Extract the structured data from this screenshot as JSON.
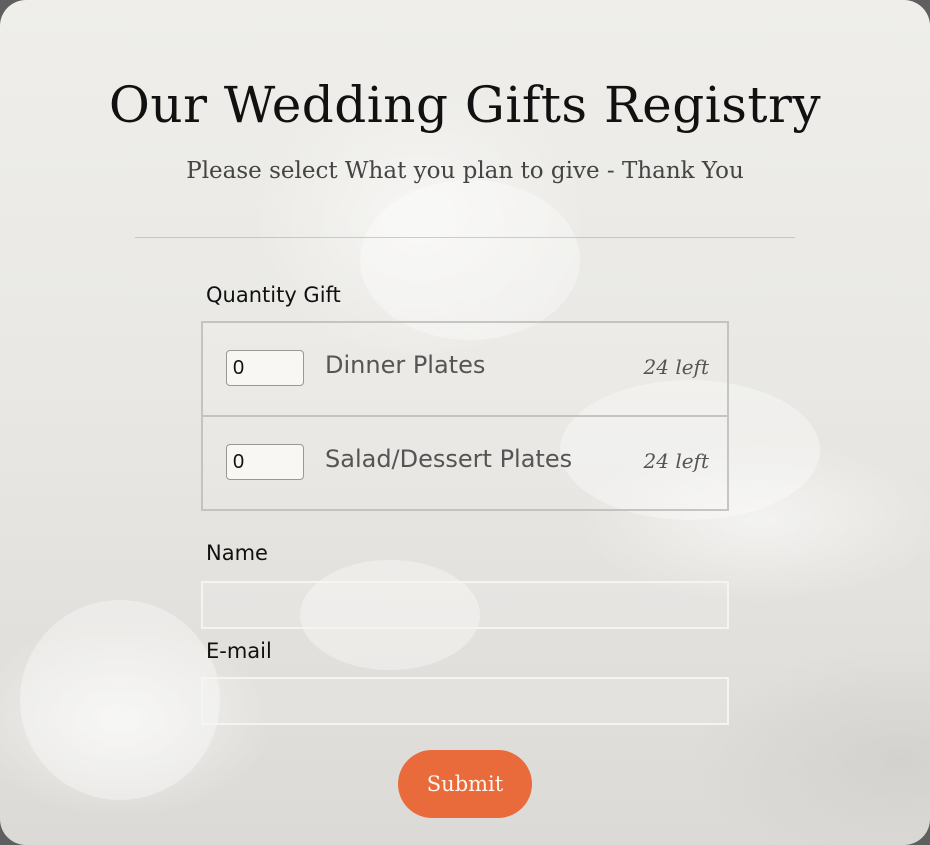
{
  "header": {
    "title": "Our Wedding Gifts Registry",
    "subtitle": "Please select What you plan to give - Thank You"
  },
  "quantity_section": {
    "label": "Quantity Gift",
    "items": [
      {
        "quantity": "0",
        "name": "Dinner Plates",
        "remaining": "24 left"
      },
      {
        "quantity": "0",
        "name": "Salad/Dessert Plates",
        "remaining": "24 left"
      }
    ]
  },
  "name_field": {
    "label": "Name",
    "value": ""
  },
  "email_field": {
    "label": "E-mail",
    "value": ""
  },
  "submit": {
    "label": "Submit"
  },
  "colors": {
    "accent": "#e96a3a",
    "text": "#111111",
    "muted": "#555555"
  }
}
